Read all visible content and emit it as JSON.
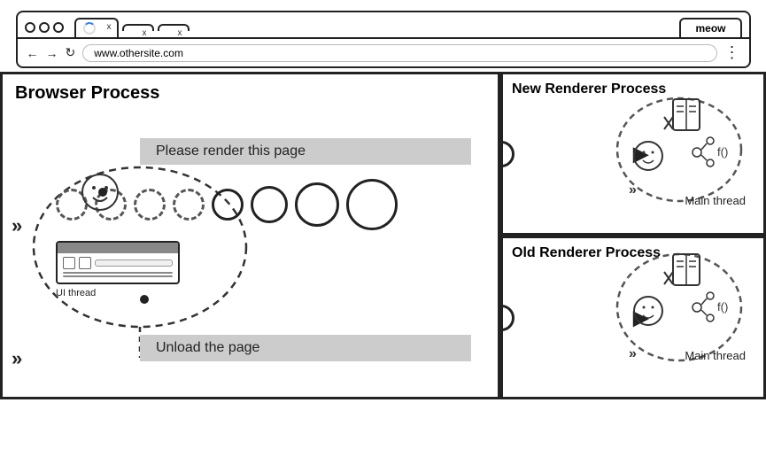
{
  "browser": {
    "tabs": [
      {
        "label": "",
        "loading": true
      },
      {
        "label": "",
        "loading": false
      },
      {
        "label": "",
        "loading": false
      }
    ],
    "active_tab": "meow",
    "url": "www.othersite.com",
    "nav": {
      "back": "←",
      "forward": "→",
      "reload": "↻",
      "menu": "⋮"
    }
  },
  "browser_process": {
    "title": "Browser Process",
    "render_message": "Please render this page",
    "unload_message": "Unload the page",
    "ui_thread_label": "UI thread"
  },
  "new_renderer": {
    "title": "New Renderer Process",
    "main_thread_label": "Main thread"
  },
  "old_renderer": {
    "title": "Old Renderer Process",
    "main_thread_label": "Main thread"
  },
  "chevrons": "»",
  "colors": {
    "border": "#222",
    "bubble_bg": "#cccccc",
    "dot_path": "#555"
  }
}
